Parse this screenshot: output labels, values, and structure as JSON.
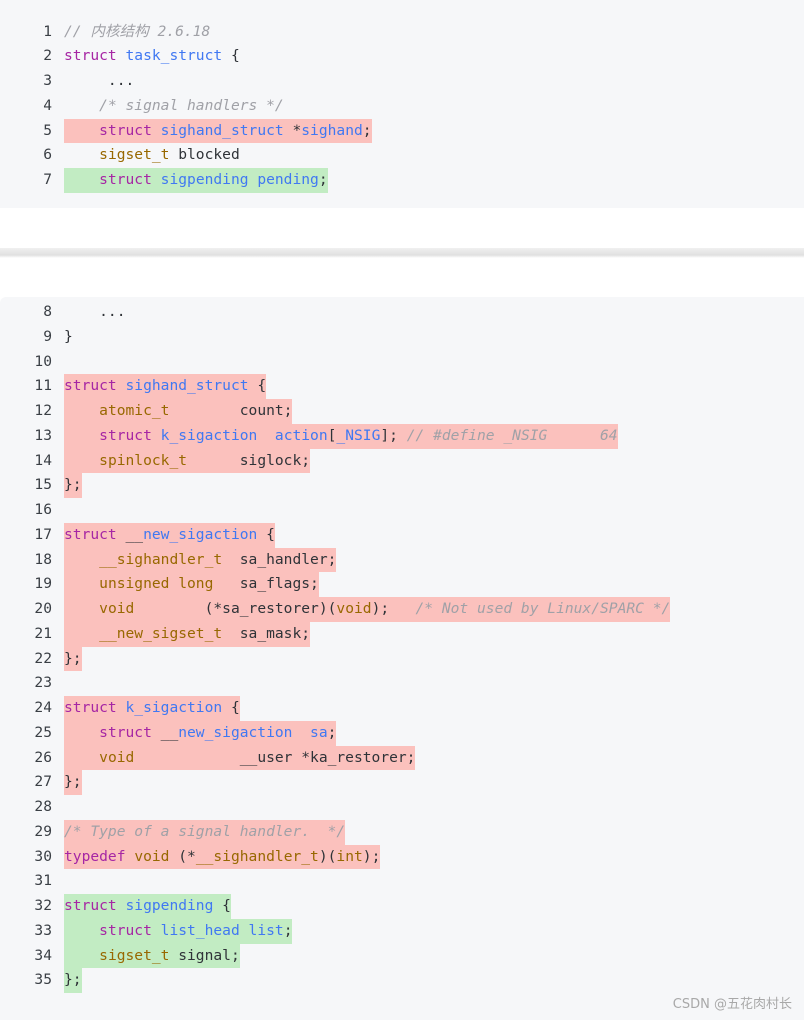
{
  "block1": {
    "lines": [
      {
        "n": "1",
        "hl": "",
        "toks": [
          [
            "cm",
            "// 内核结构 2.6.18"
          ]
        ]
      },
      {
        "n": "2",
        "hl": "",
        "toks": [
          [
            "kw",
            "struct"
          ],
          [
            "",
            " "
          ],
          [
            "fn",
            "task_struct"
          ],
          [
            "",
            " {"
          ]
        ]
      },
      {
        "n": "3",
        "hl": "",
        "toks": [
          [
            "",
            "     ..."
          ]
        ]
      },
      {
        "n": "4",
        "hl": "",
        "toks": [
          [
            "",
            "    "
          ],
          [
            "cm",
            "/* signal handlers */"
          ]
        ]
      },
      {
        "n": "5",
        "hl": "red",
        "toks": [
          [
            "",
            "    "
          ],
          [
            "kw",
            "struct"
          ],
          [
            "",
            " "
          ],
          [
            "fn",
            "sighand_struct"
          ],
          [
            "",
            " *"
          ],
          [
            "fn",
            "sighand"
          ],
          [
            "",
            ";"
          ]
        ]
      },
      {
        "n": "6",
        "hl": "",
        "toks": [
          [
            "",
            "    "
          ],
          [
            "ty",
            "sigset_t"
          ],
          [
            "",
            " blocked"
          ]
        ]
      },
      {
        "n": "7",
        "hl": "green",
        "toks": [
          [
            "",
            "    "
          ],
          [
            "kw",
            "struct"
          ],
          [
            "",
            " "
          ],
          [
            "fn",
            "sigpending pending"
          ],
          [
            "",
            ";"
          ]
        ]
      }
    ]
  },
  "block2": {
    "lines": [
      {
        "n": "8",
        "hl": "",
        "toks": [
          [
            "",
            "    ..."
          ]
        ]
      },
      {
        "n": "9",
        "hl": "",
        "toks": [
          [
            "",
            "}"
          ]
        ]
      },
      {
        "n": "10",
        "hl": "",
        "toks": []
      },
      {
        "n": "11",
        "hl": "red",
        "toks": [
          [
            "kw",
            "struct"
          ],
          [
            "",
            " "
          ],
          [
            "fn",
            "sighand_struct"
          ],
          [
            "",
            " {"
          ]
        ]
      },
      {
        "n": "12",
        "hl": "red",
        "toks": [
          [
            "",
            "    "
          ],
          [
            "ty",
            "atomic_t"
          ],
          [
            "",
            "        count;"
          ]
        ]
      },
      {
        "n": "13",
        "hl": "red",
        "toks": [
          [
            "",
            "    "
          ],
          [
            "kw",
            "struct"
          ],
          [
            "",
            " "
          ],
          [
            "fn",
            "k_sigaction"
          ],
          [
            "",
            "  "
          ],
          [
            "fn",
            "action"
          ],
          [
            "",
            "["
          ],
          [
            "fn",
            "_NSIG"
          ],
          [
            "",
            "]; "
          ],
          [
            "cm",
            "// #define _NSIG      64"
          ]
        ]
      },
      {
        "n": "14",
        "hl": "red",
        "toks": [
          [
            "",
            "    "
          ],
          [
            "ty",
            "spinlock_t"
          ],
          [
            "",
            "      siglock;"
          ]
        ]
      },
      {
        "n": "15",
        "hl": "red",
        "toks": [
          [
            "",
            "};"
          ]
        ]
      },
      {
        "n": "16",
        "hl": "",
        "toks": []
      },
      {
        "n": "17",
        "hl": "red",
        "toks": [
          [
            "kw",
            "struct"
          ],
          [
            "",
            " __"
          ],
          [
            "fn",
            "new_sigaction"
          ],
          [
            "",
            " {"
          ]
        ]
      },
      {
        "n": "18",
        "hl": "red",
        "toks": [
          [
            "",
            "    "
          ],
          [
            "ty",
            "__sighandler_t"
          ],
          [
            "",
            "  sa_handler;"
          ]
        ]
      },
      {
        "n": "19",
        "hl": "red",
        "toks": [
          [
            "",
            "    "
          ],
          [
            "ty",
            "unsigned long"
          ],
          [
            "",
            "   sa_flags;"
          ]
        ]
      },
      {
        "n": "20",
        "hl": "red",
        "toks": [
          [
            "",
            "    "
          ],
          [
            "ty",
            "void"
          ],
          [
            "",
            "        (*sa_restorer)("
          ],
          [
            "ty",
            "void"
          ],
          [
            "",
            ");   "
          ],
          [
            "cm",
            "/* Not used by Linux/SPARC */"
          ]
        ]
      },
      {
        "n": "21",
        "hl": "red",
        "toks": [
          [
            "",
            "    "
          ],
          [
            "ty",
            "__new_sigset_t"
          ],
          [
            "",
            "  sa_mask;"
          ]
        ]
      },
      {
        "n": "22",
        "hl": "red",
        "toks": [
          [
            "",
            "};"
          ]
        ]
      },
      {
        "n": "23",
        "hl": "",
        "toks": []
      },
      {
        "n": "24",
        "hl": "red",
        "toks": [
          [
            "kw",
            "struct"
          ],
          [
            "",
            " "
          ],
          [
            "fn",
            "k_sigaction"
          ],
          [
            "",
            " {"
          ]
        ]
      },
      {
        "n": "25",
        "hl": "red",
        "toks": [
          [
            "",
            "    "
          ],
          [
            "kw",
            "struct"
          ],
          [
            "",
            " __"
          ],
          [
            "fn",
            "new_sigaction"
          ],
          [
            "",
            "  "
          ],
          [
            "fn",
            "sa"
          ],
          [
            "",
            ";"
          ]
        ]
      },
      {
        "n": "26",
        "hl": "red",
        "toks": [
          [
            "",
            "    "
          ],
          [
            "ty",
            "void"
          ],
          [
            "",
            "            __user *ka_restorer;"
          ]
        ]
      },
      {
        "n": "27",
        "hl": "red",
        "toks": [
          [
            "",
            "};"
          ]
        ]
      },
      {
        "n": "28",
        "hl": "",
        "toks": []
      },
      {
        "n": "29",
        "hl": "red",
        "toks": [
          [
            "cm",
            "/* Type of a signal handler.  */"
          ]
        ]
      },
      {
        "n": "30",
        "hl": "red",
        "toks": [
          [
            "kw",
            "typedef"
          ],
          [
            "",
            " "
          ],
          [
            "ty",
            "void"
          ],
          [
            "",
            " (*"
          ],
          [
            "ty",
            "__sighandler_t"
          ],
          [
            "",
            ")("
          ],
          [
            "ty",
            "int"
          ],
          [
            "",
            ");"
          ]
        ]
      },
      {
        "n": "31",
        "hl": "",
        "toks": []
      },
      {
        "n": "32",
        "hl": "green",
        "toks": [
          [
            "kw",
            "struct"
          ],
          [
            "",
            " "
          ],
          [
            "fn",
            "sigpending"
          ],
          [
            "",
            " {"
          ]
        ]
      },
      {
        "n": "33",
        "hl": "green",
        "toks": [
          [
            "",
            "    "
          ],
          [
            "kw",
            "struct"
          ],
          [
            "",
            " "
          ],
          [
            "fn",
            "list_head list"
          ],
          [
            "",
            ";"
          ]
        ]
      },
      {
        "n": "34",
        "hl": "green",
        "toks": [
          [
            "",
            "    "
          ],
          [
            "ty",
            "sigset_t"
          ],
          [
            "",
            " signal;"
          ]
        ]
      },
      {
        "n": "35",
        "hl": "green",
        "toks": [
          [
            "",
            "};"
          ]
        ]
      }
    ]
  },
  "watermark": "CSDN @五花肉村长",
  "colors": {
    "keyword": "#a626a4",
    "identifier": "#4078f2",
    "type": "#986801",
    "comment": "#a0a1a7",
    "highlight_red": "#fbc1bd",
    "highlight_green": "#c2ecc3"
  }
}
